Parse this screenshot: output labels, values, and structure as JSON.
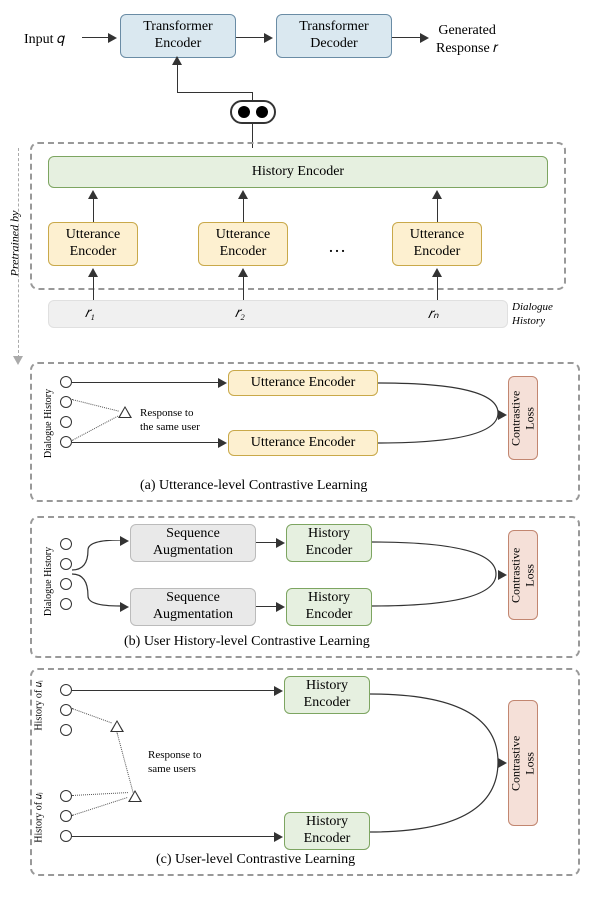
{
  "top": {
    "input_label": "Input 𝑞",
    "encoder": "Transformer\nEncoder",
    "decoder": "Transformer\nDecoder",
    "output_label": "Generated\nResponse 𝑟"
  },
  "upper": {
    "history_encoder": "History Encoder",
    "utterance_encoder": "Utterance\nEncoder",
    "ellipsis": "…",
    "r1": "𝑟₁",
    "r2": "𝑟₂",
    "rn": "𝑟ₙ",
    "dialogue_history": "Dialogue\nHistory",
    "pretrained_by": "Pretrained by"
  },
  "panel_a": {
    "vlabel": "Dialogue History",
    "utterance_encoder": "Utterance Encoder",
    "loss": "Contrastive\nLoss",
    "response_label": "Response to\nthe same user",
    "caption": "(a) Utterance-level Contrastive Learning"
  },
  "panel_b": {
    "vlabel": "Dialogue History",
    "seq_aug": "Sequence\nAugmentation",
    "history_encoder": "History\nEncoder",
    "loss": "Contrastive\nLoss",
    "caption": "(b) User History-level Contrastive Learning"
  },
  "panel_c": {
    "vlabel_ui": "History of 𝑢ᵢ",
    "vlabel_uj": "History of 𝑢ⱼ",
    "history_encoder": "History\nEncoder",
    "loss": "Contrastive\nLoss",
    "response_label": "Response to\nsame users",
    "caption": "(c) User-level Contrastive Learning"
  }
}
